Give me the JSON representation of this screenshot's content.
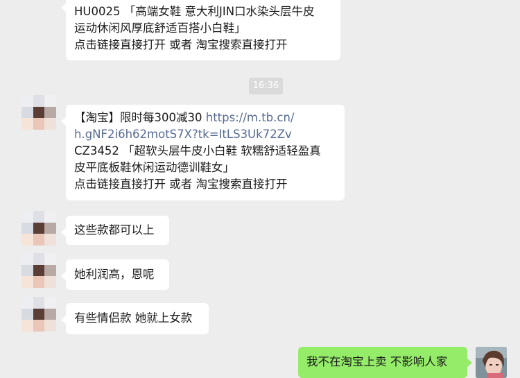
{
  "messages": [
    {
      "id": "m1",
      "lines": [
        "HU0025 「高端女鞋 意大利JIN口水染头层牛皮",
        "运动休闲风厚底舒适百搭小白鞋」",
        "点击链接直接打开 或者 淘宝搜索直接打开"
      ]
    },
    {
      "id": "m2",
      "line1_prefix": "【淘宝】限时每300减30 ",
      "line1_link": "https://m.tb.cn/",
      "line2_link": "h.gNF2i6h62motS7X?tk=ItLS3Uk72Zv",
      "lines": [
        "CZ3452 「超软头层牛皮小白鞋 软糯舒适轻盈真",
        "皮平底板鞋休闲运动德训鞋女」",
        "点击链接直接打开 或者 淘宝搜索直接打开"
      ]
    },
    {
      "id": "m3",
      "text": "这些款都可以上"
    },
    {
      "id": "m4",
      "text": "她利润高，恩呢"
    },
    {
      "id": "m5",
      "text": "有些情侣款 她就上女款"
    },
    {
      "id": "m6",
      "text": "我不在淘宝上卖 不影响人家"
    }
  ],
  "timestamp": "16:36",
  "colors": {
    "background": "#ededed",
    "bubble_in": "#ffffff",
    "bubble_out": "#95ec69",
    "link": "#576b95"
  }
}
